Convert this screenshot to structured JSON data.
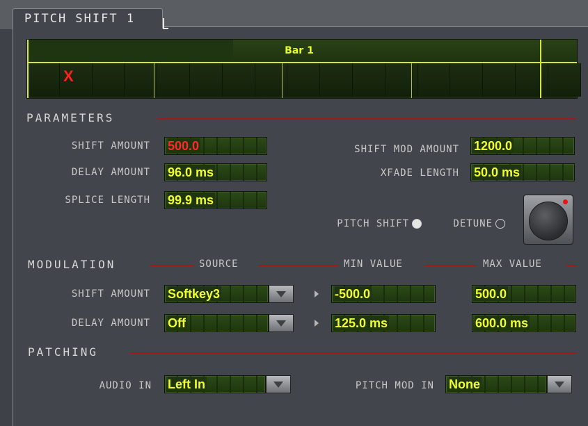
{
  "tab": {
    "title": "PITCH SHIFT 1"
  },
  "timeline": {
    "bar_label": "Bar 1",
    "marker": "X",
    "marker_color": "#ff2020"
  },
  "parameters": {
    "header": "PARAMETERS",
    "shift_amount": {
      "label": "SHIFT AMOUNT",
      "value": "500.0"
    },
    "delay_amount": {
      "label": "DELAY AMOUNT",
      "value": "96.0 ms"
    },
    "splice_length": {
      "label": "SPLICE LENGTH",
      "value": "99.9 ms"
    },
    "shift_mod_amount": {
      "label": "SHIFT MOD AMOUNT",
      "value": "1200.0"
    },
    "xfade_length": {
      "label": "XFADE LENGTH",
      "value": "50.0 ms"
    },
    "mode": {
      "pitch_shift": "PITCH SHIFT",
      "detune": "DETUNE",
      "selected": "PITCH SHIFT"
    }
  },
  "modulation": {
    "header": "MODULATION",
    "col_source": "SOURCE",
    "col_min": "MIN VALUE",
    "col_max": "MAX VALUE",
    "rows": [
      {
        "label": "SHIFT AMOUNT",
        "source": "Softkey3",
        "min": "-500.0",
        "max": "500.0"
      },
      {
        "label": "DELAY AMOUNT",
        "source": "Off",
        "min": "125.0 ms",
        "max": "600.0 ms"
      }
    ]
  },
  "patching": {
    "header": "PATCHING",
    "audio_in": {
      "label": "AUDIO IN",
      "value": "Left In"
    },
    "pitch_mod_in": {
      "label": "PITCH MOD IN",
      "value": "None"
    }
  },
  "colors": {
    "value_text": "#f2ff2e",
    "accent_line": "#9c1c1c",
    "timeline_line": "#d6e830"
  }
}
